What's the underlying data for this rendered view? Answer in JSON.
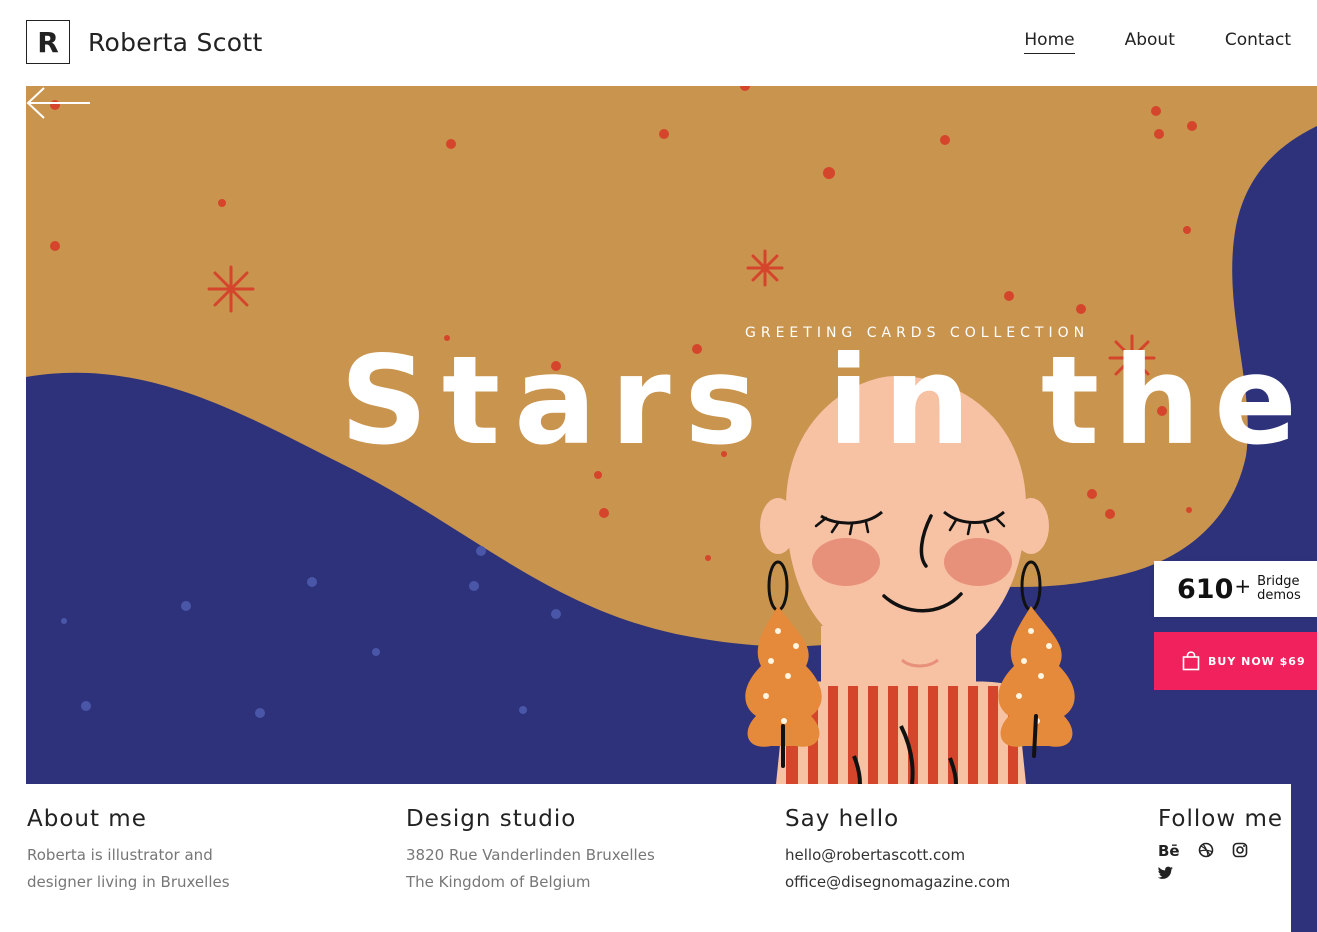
{
  "header": {
    "logo_letter": "R",
    "brand": "Roberta Scott",
    "nav": [
      "Home",
      "About",
      "Contact"
    ],
    "active_nav": "Home"
  },
  "hero": {
    "subtitle": "GREETING CARDS COLLECTION",
    "headline": "Stars in the ho"
  },
  "widgets": {
    "demos_count": "610",
    "demos_plus": "+",
    "demos_label_1": "Bridge",
    "demos_label_2": "demos",
    "buy_label": "BUY NOW $69"
  },
  "footer": {
    "about": {
      "title": "About me",
      "line1": "Roberta is illustrator and",
      "line2": "designer living in Bruxelles"
    },
    "studio": {
      "title": "Design studio",
      "line1": "3820 Rue Vanderlinden Bruxelles",
      "line2": "The Kingdom of Belgium"
    },
    "hello": {
      "title": "Say hello",
      "line1": "hello@robertascott.com",
      "line2": "office@disegnomagazine.com"
    },
    "follow": {
      "title": "Follow me",
      "icons": [
        "behance-icon",
        "dribbble-icon",
        "instagram-icon",
        "twitter-icon"
      ],
      "behance_text": "Bē"
    }
  },
  "colors": {
    "hair": "#c9944e",
    "navy": "#2d327b",
    "dots": "#d5452c",
    "skin": "#f7c1a4",
    "cheek": "#e8917a",
    "earring": "#e58a3a",
    "accent": "#f0215c"
  }
}
